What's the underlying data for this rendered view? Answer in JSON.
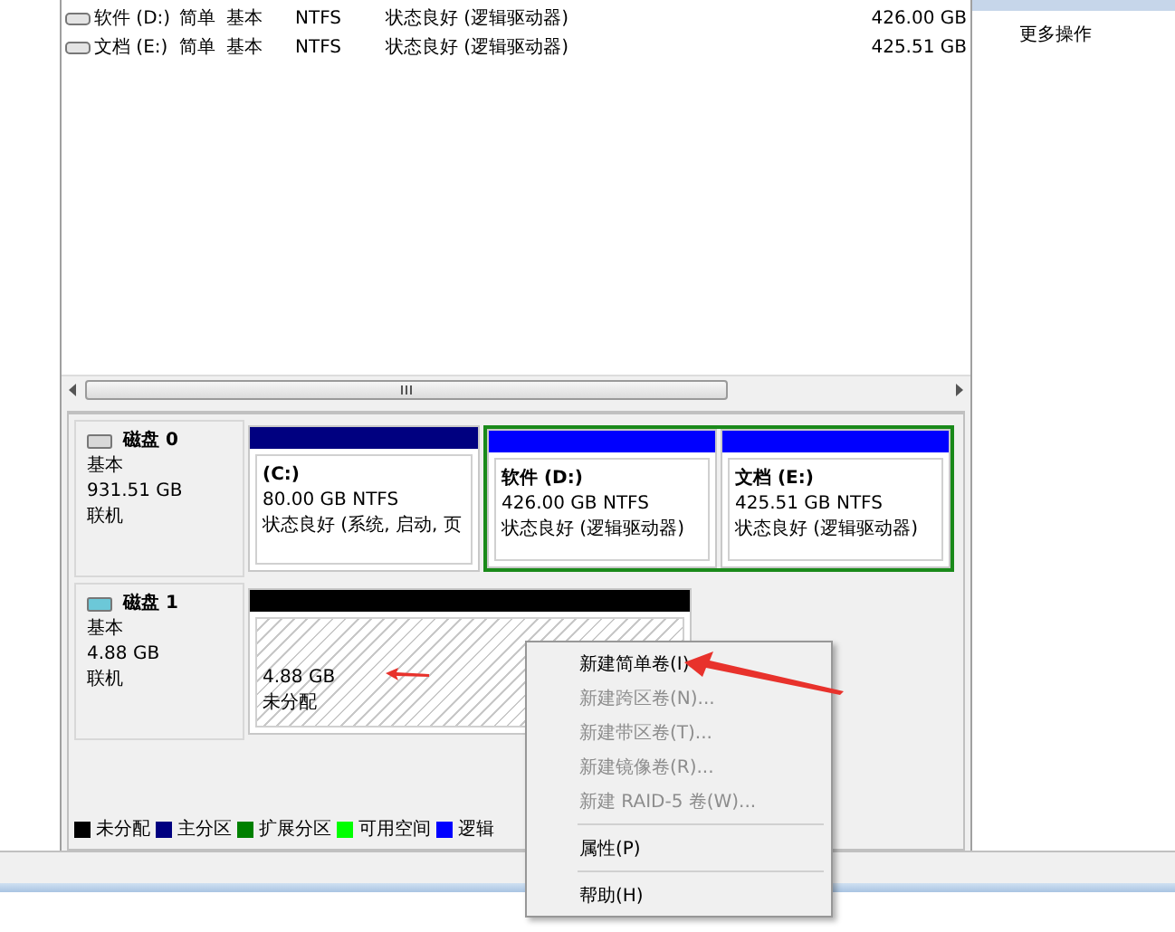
{
  "volumes": [
    {
      "name": "软件 (D:)",
      "layout": "简单",
      "type": "基本",
      "fs": "NTFS",
      "status": "状态良好 (逻辑驱动器)",
      "capacity": "426.00 GB"
    },
    {
      "name": "文档 (E:)",
      "layout": "简单",
      "type": "基本",
      "fs": "NTFS",
      "status": "状态良好 (逻辑驱动器)",
      "capacity": "425.51 GB"
    }
  ],
  "actions": {
    "items": [
      "更多操作"
    ]
  },
  "disks": [
    {
      "title": "磁盘 0",
      "removable": false,
      "type": "基本",
      "size": "931.51 GB",
      "status": "联机",
      "partitions": [
        {
          "kind": "primary",
          "label": "(C:)",
          "size": "80.00 GB NTFS",
          "status": "状态良好 (系统, 启动, 页"
        },
        {
          "kind": "extended",
          "children": [
            {
              "kind": "logical",
              "label": "软件  (D:)",
              "size": "426.00 GB NTFS",
              "status": "状态良好 (逻辑驱动器)"
            },
            {
              "kind": "logical",
              "label": "文档  (E:)",
              "size": "425.51 GB NTFS",
              "status": "状态良好 (逻辑驱动器)"
            }
          ]
        }
      ]
    },
    {
      "title": "磁盘 1",
      "removable": true,
      "type": "基本",
      "size": "4.88 GB",
      "status": "联机",
      "partitions": [
        {
          "kind": "unallocated",
          "size": "4.88 GB",
          "status": "未分配"
        }
      ]
    }
  ],
  "legend": [
    {
      "label": "未分配",
      "color": "#000000"
    },
    {
      "label": "主分区",
      "color": "#000080"
    },
    {
      "label": "扩展分区",
      "color": "#008000"
    },
    {
      "label": "可用空间",
      "color": "#00ff00"
    },
    {
      "label": "逻辑",
      "color": "#0000ff"
    }
  ],
  "context_menu": [
    [
      {
        "label": "新建简单卷(I)",
        "disabled": false
      },
      {
        "label": "新建跨区卷(N)...",
        "disabled": true
      },
      {
        "label": "新建带区卷(T)...",
        "disabled": true
      },
      {
        "label": "新建镜像卷(R)...",
        "disabled": true
      },
      {
        "label": "新建 RAID-5 卷(W)...",
        "disabled": true
      }
    ],
    [
      {
        "label": "属性(P)",
        "disabled": false
      }
    ],
    [
      {
        "label": "帮助(H)",
        "disabled": false
      }
    ]
  ]
}
